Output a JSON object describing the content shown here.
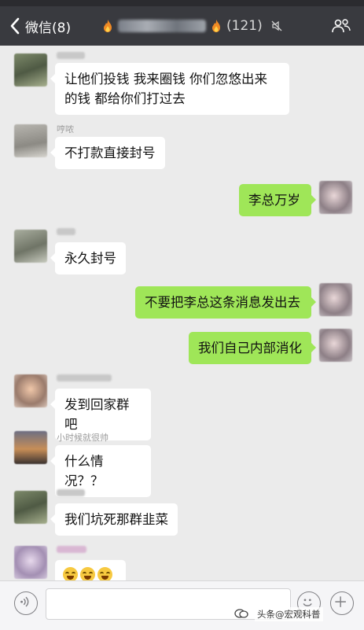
{
  "header": {
    "back_label": "微信(8)",
    "group_count": "(121)"
  },
  "messages": [
    {
      "side": "in",
      "text": "让他们投钱 我来圈钱 你们忽悠出来的钱 都给你们打过去"
    },
    {
      "side": "in",
      "sender": "哼哝",
      "text": "不打款直接封号"
    },
    {
      "side": "out",
      "text": "李总万岁"
    },
    {
      "side": "in",
      "text": "永久封号"
    },
    {
      "side": "out",
      "text": "不要把李总这条消息发出去"
    },
    {
      "side": "out",
      "text": "我们自己内部消化"
    },
    {
      "side": "in",
      "text": "发到回家群吧"
    },
    {
      "side": "in",
      "sender": "小时候就很帅",
      "text": "什么情况？？"
    },
    {
      "side": "in",
      "text": "我们坑死那群韭菜"
    },
    {
      "side": "in",
      "text": "",
      "emoji": "grinning-sweat-emoji ×3"
    }
  ],
  "input": {
    "placeholder": ""
  },
  "watermark": {
    "text": "头条@宏观科普"
  },
  "colors": {
    "header_bg": "#393a3f",
    "chat_bg": "#ebebeb",
    "out_bubble": "#9fe658",
    "in_bubble": "#ffffff"
  }
}
